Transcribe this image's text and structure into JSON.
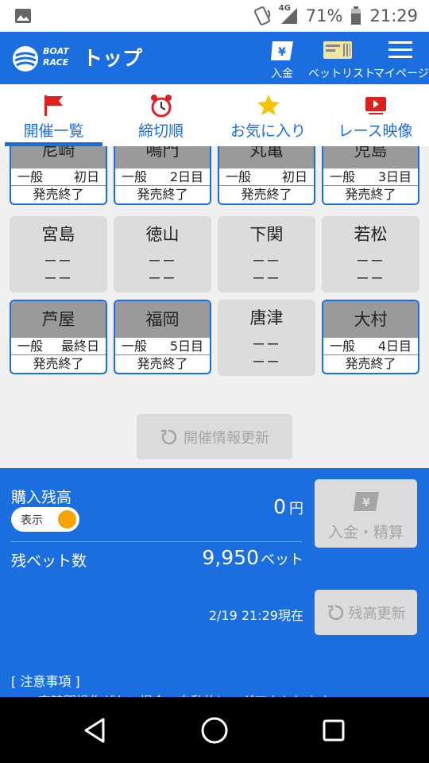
{
  "status_bar": {
    "network": "4G",
    "battery": "71%",
    "time": "21:29"
  },
  "header": {
    "logo_line1": "BOAT",
    "logo_line2": "RACE",
    "title": "トップ",
    "deposit": "入金",
    "betlist": "ベットリスト",
    "mypage": "マイページ"
  },
  "tabs": [
    {
      "label": "開催一覧",
      "icon": "flag-icon"
    },
    {
      "label": "締切順",
      "icon": "alarm-clock-icon"
    },
    {
      "label": "お気に入り",
      "icon": "star-icon"
    },
    {
      "label": "レース映像",
      "icon": "video-icon"
    }
  ],
  "venues": [
    {
      "name": "尼崎",
      "grade": "一般",
      "day": "初日",
      "status": "発売終了",
      "active": true
    },
    {
      "name": "鳴門",
      "grade": "一般",
      "day": "2日目",
      "status": "発売終了",
      "active": true
    },
    {
      "name": "丸亀",
      "grade": "一般",
      "day": "初日",
      "status": "発売終了",
      "active": true
    },
    {
      "name": "児島",
      "grade": "一般",
      "day": "3日目",
      "status": "発売終了",
      "active": true
    },
    {
      "name": "宮島",
      "dash1": "ーー",
      "dash2": "ーー",
      "active": false
    },
    {
      "name": "徳山",
      "dash1": "ーー",
      "dash2": "ーー",
      "active": false
    },
    {
      "name": "下関",
      "dash1": "ーー",
      "dash2": "ーー",
      "active": false
    },
    {
      "name": "若松",
      "dash1": "ーー",
      "dash2": "ーー",
      "active": false
    },
    {
      "name": "芦屋",
      "grade": "一般",
      "day": "最終日",
      "status": "発売終了",
      "active": true
    },
    {
      "name": "福岡",
      "grade": "一般",
      "day": "5日目",
      "status": "発売終了",
      "active": true
    },
    {
      "name": "唐津",
      "dash1": "ーー",
      "dash2": "ーー",
      "active": false
    },
    {
      "name": "大村",
      "grade": "一般",
      "day": "4日目",
      "status": "発売終了",
      "active": true
    }
  ],
  "refresh_info_label": "開催情報更新",
  "account": {
    "title": "購入残高",
    "toggle_label": "表示",
    "balance": "0",
    "balance_unit": "円",
    "deposit_label": "入金・精算",
    "bets_label": "残ベット数",
    "bets_value": "9,950",
    "bets_unit": "ベット",
    "timestamp": "2/19 21:29現在",
    "refresh_label": "残高更新",
    "notice_title": "[ 注意事項 ]",
    "notice_text": "一定時間操作がない場合、自動的にログアウトします。"
  },
  "colors": {
    "brand": "#1a6ee0",
    "accent": "#f5a300",
    "disabled": "#dcdcdc"
  }
}
